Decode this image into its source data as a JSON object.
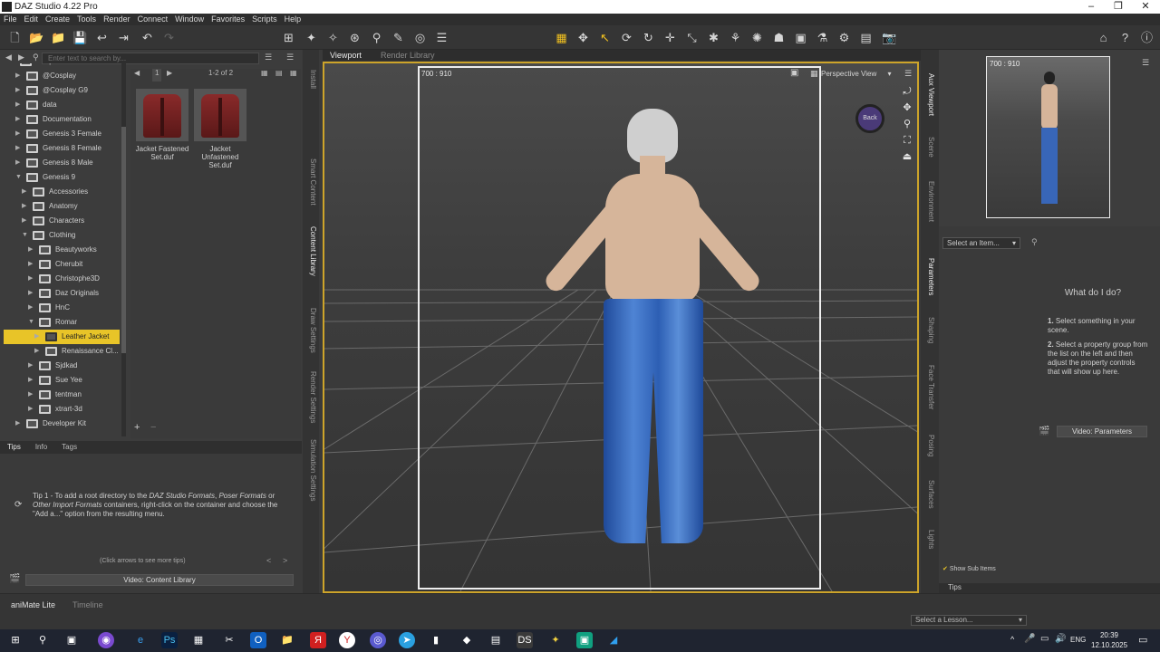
{
  "window": {
    "title": "DAZ Studio 4.22 Pro"
  },
  "menu": [
    "File",
    "Edit",
    "Create",
    "Tools",
    "Render",
    "Connect",
    "Window",
    "Favorites",
    "Scripts",
    "Help"
  ],
  "content_library": {
    "search_placeholder": "Enter text to search by...",
    "tree": [
      {
        "label": "People",
        "level": 0,
        "expanded": true
      },
      {
        "label": "@Cosplay",
        "level": 1
      },
      {
        "label": "@Cosplay G9",
        "level": 1
      },
      {
        "label": "data",
        "level": 1
      },
      {
        "label": "Documentation",
        "level": 1
      },
      {
        "label": "Genesis 3 Female",
        "level": 1
      },
      {
        "label": "Genesis 8 Female",
        "level": 1
      },
      {
        "label": "Genesis 8 Male",
        "level": 1
      },
      {
        "label": "Genesis 9",
        "level": 1,
        "expanded": true
      },
      {
        "label": "Accessories",
        "level": 2
      },
      {
        "label": "Anatomy",
        "level": 2
      },
      {
        "label": "Characters",
        "level": 2
      },
      {
        "label": "Clothing",
        "level": 2,
        "expanded": true
      },
      {
        "label": "Beautyworks",
        "level": 3
      },
      {
        "label": "Cherubit",
        "level": 3
      },
      {
        "label": "Christophe3D",
        "level": 3
      },
      {
        "label": "Daz Originals",
        "level": 3
      },
      {
        "label": "HnC",
        "level": 3
      },
      {
        "label": "Romar",
        "level": 3,
        "expanded": true
      },
      {
        "label": "Leather Jacket",
        "level": 4,
        "selected": true
      },
      {
        "label": "Renaissance Cl...",
        "level": 4
      },
      {
        "label": "Sjdkad",
        "level": 3
      },
      {
        "label": "Sue Yee",
        "level": 3
      },
      {
        "label": "tentman",
        "level": 3
      },
      {
        "label": "xtrart-3d",
        "level": 3
      },
      {
        "label": "Developer Kit",
        "level": 1
      }
    ],
    "page_nav": {
      "page": "1",
      "count": "1-2 of 2"
    },
    "items": [
      {
        "label": "Jacket Fastened Set.duf"
      },
      {
        "label": "Jacket Unfastened Set.duf"
      }
    ]
  },
  "left_tabs": [
    "Install",
    "Smart Content",
    "Content Library",
    "Draw Settings",
    "Render Settings",
    "Simulation Settings"
  ],
  "tips": {
    "tabs": [
      "Tips",
      "Info",
      "Tags"
    ],
    "text_prefix": "Tip 1 - To add a root directory to the ",
    "text_i1": "DAZ Studio Formats",
    "text_mid1": ", ",
    "text_i2": "Poser Formats",
    "text_mid2": " or ",
    "text_i3": "Other Import Formats",
    "text_suffix": " containers, right-click on the container and choose the \"Add a...\" option from the resulting menu.",
    "nav_hint": "(Click arrows to see more tips)",
    "video_button": "Video: Content Library"
  },
  "viewport": {
    "tabs": [
      "Viewport",
      "Render Library"
    ],
    "resolution": "700 : 910",
    "camera": "Perspective View",
    "cube_label": "Back"
  },
  "aux_viewport": {
    "resolution": "700 : 910"
  },
  "right_tabs": [
    "Aux Viewport",
    "Scene",
    "Environment",
    "Parameters",
    "Shaping",
    "Face Transfer",
    "Posing",
    "Surfaces",
    "Lights"
  ],
  "parameters": {
    "select_item": "Select an Item...",
    "what_do_i_do": "What do I do?",
    "step1_num": "1.",
    "step1": "Select something in your scene.",
    "step2_num": "2.",
    "step2": "Select a property group from the list on the left and then adjust the property controls that will show up here.",
    "video_button": "Video: Parameters",
    "show_sub_items": "Show Sub Items",
    "tips_tab": "Tips"
  },
  "bottom": {
    "tabs": [
      "aniMate Lite",
      "Timeline"
    ],
    "lesson_placeholder": "Select a Lesson..."
  },
  "taskbar": {
    "language": "ENG",
    "time": "20:39",
    "date": "12.10.2025"
  }
}
